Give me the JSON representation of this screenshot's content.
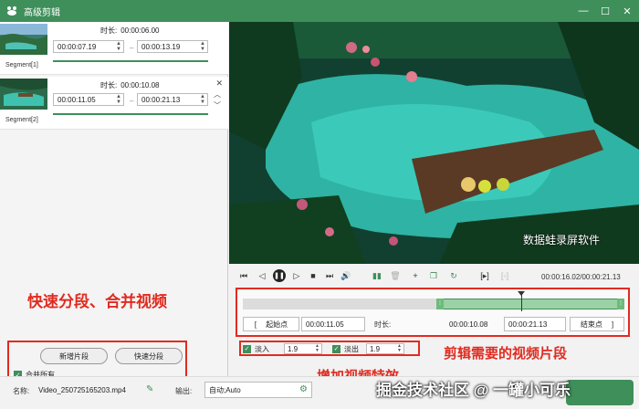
{
  "window": {
    "title": "高级剪辑",
    "minimize": "—",
    "maximize": "☐",
    "close": "✕"
  },
  "segments": [
    {
      "label": "Segment[1]",
      "duration_label": "时长:",
      "duration": "00:00:06.00",
      "start": "00:00:07.19",
      "end": "00:00:13.19"
    },
    {
      "label": "Segment[2]",
      "duration_label": "时长:",
      "duration": "00:00:10.08",
      "start": "00:00:11.05",
      "end": "00:00:21.13"
    }
  ],
  "left_annotation": "快速分段、合并视频",
  "left_controls": {
    "add_segment": "新增片段",
    "quick_split": "快速分段",
    "merge_all": "合并所有"
  },
  "video_watermark": "数据蛙录屏软件",
  "playback": {
    "timecode": "00:00:16.02/00:00:21.13"
  },
  "timeline": {
    "start_point": "起始点",
    "start_value": "00:00:11.05",
    "duration_label": "时长:",
    "duration_value": "00:00:10.08",
    "end_value": "00:00:21.13",
    "end_point": "结束点"
  },
  "fade": {
    "fade_in_label": "淡入",
    "fade_in_value": "1.9",
    "fade_out_label": "淡出",
    "fade_out_value": "1.9"
  },
  "annotations": {
    "right": "剪辑需要的视频片段",
    "bottom": "增加视频特效"
  },
  "bottom": {
    "name_label": "名称:",
    "name_value": "Video_250725165203.mp4",
    "output_label": "输出:",
    "output_value": "自动;Auto",
    "watermark": "掘金技术社区 @ 一罐小可乐"
  },
  "colors": {
    "accent": "#3f8f5a",
    "annotation": "#e02b20"
  }
}
